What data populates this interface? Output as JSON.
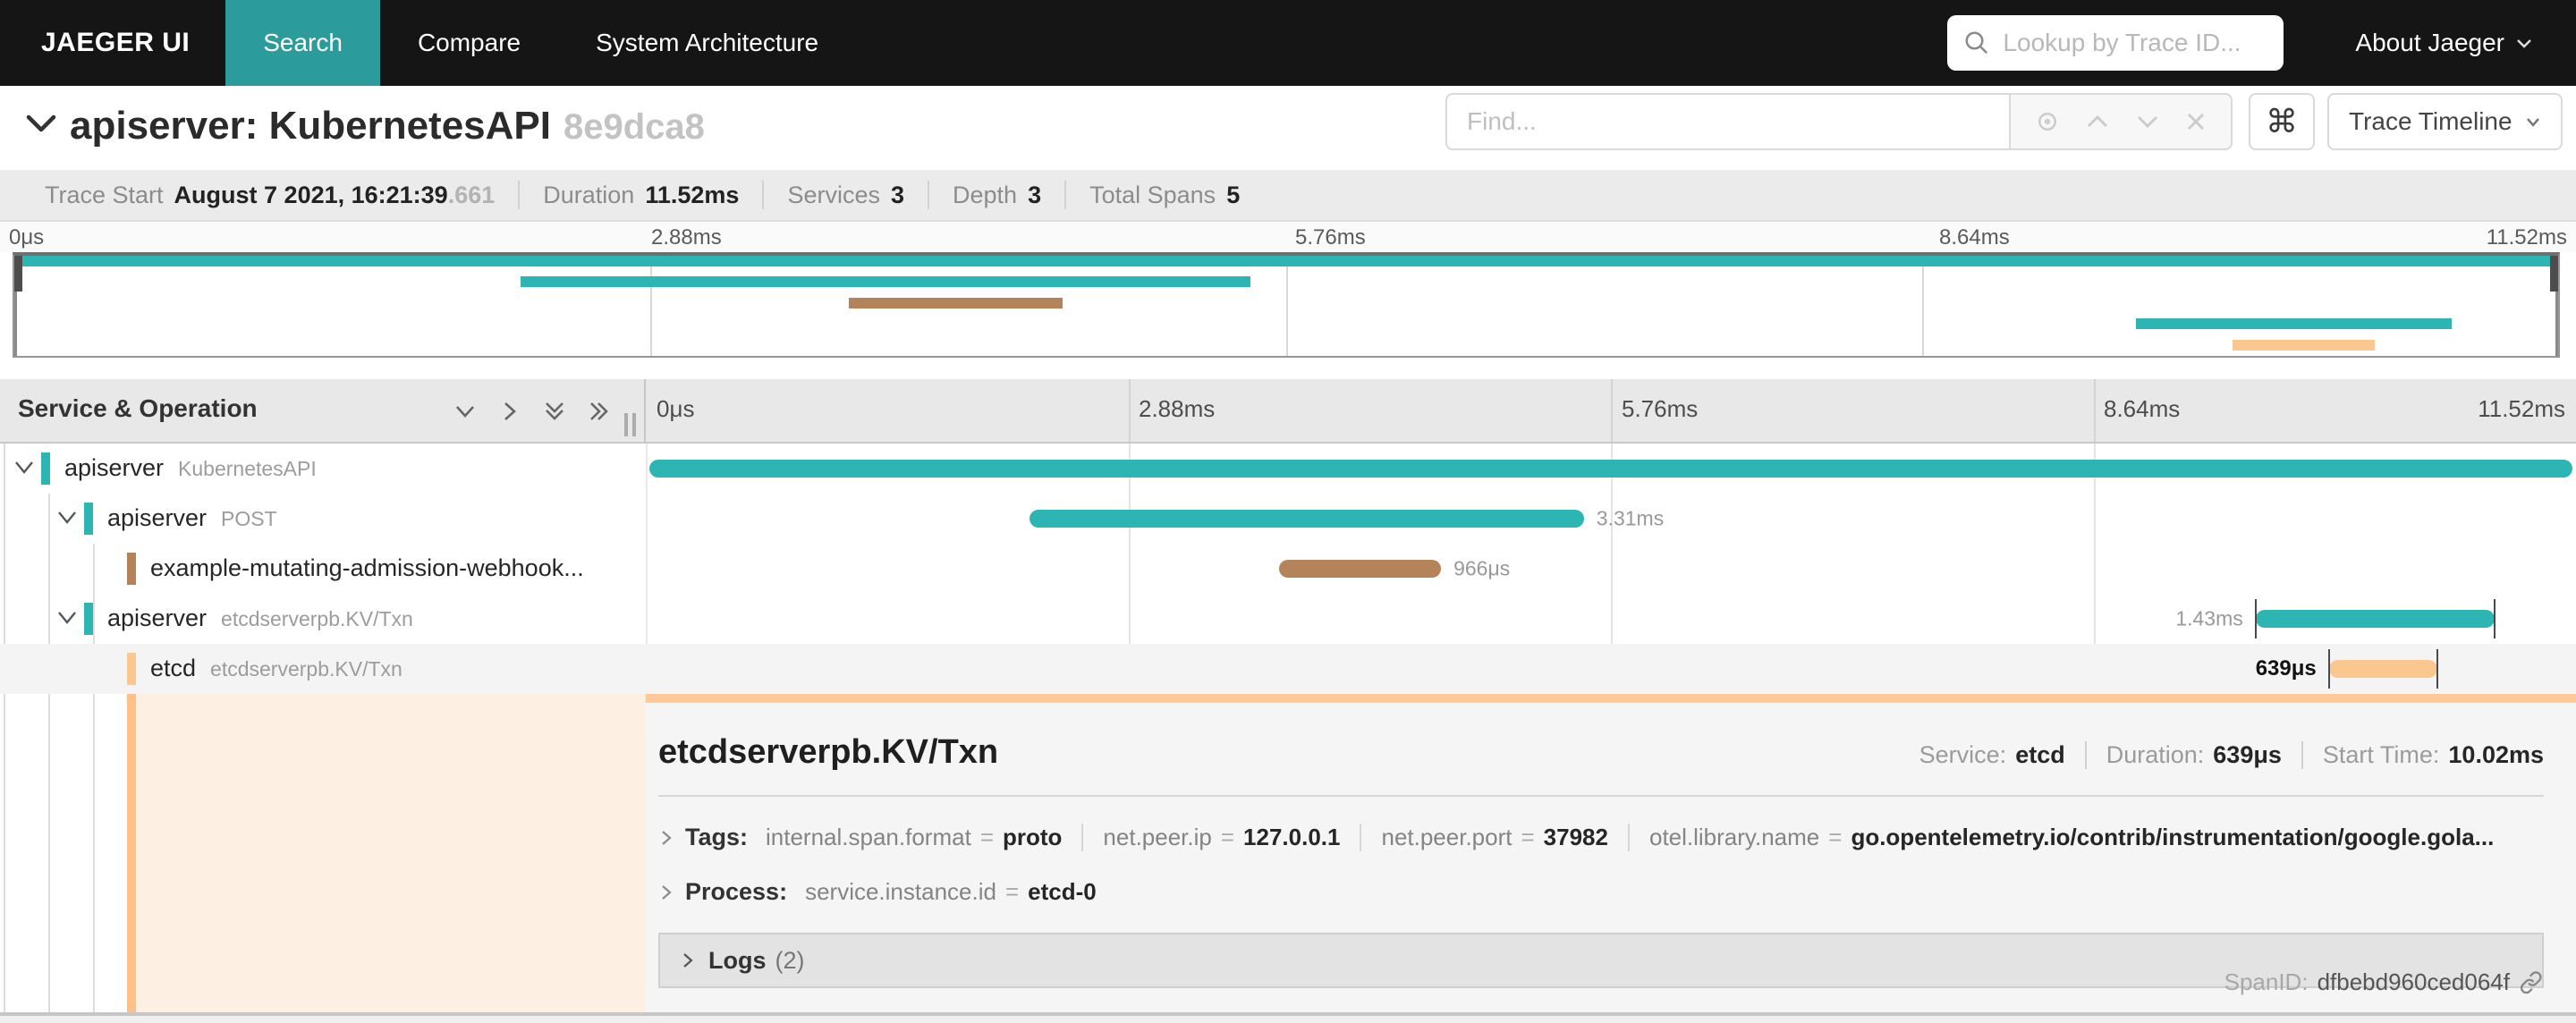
{
  "colors": {
    "teal_span": "#2cb5b2",
    "brown_span": "#b5835a",
    "peach_span": "#fac88f",
    "detail_accent": "#ffc189",
    "nav_active": "#2b9c9b",
    "nav_bg": "#151515",
    "selected_row_bg": "#f4f4f4",
    "detail_bg": "#f5f5f5"
  },
  "nav": {
    "brand": "JAEGER UI",
    "items": [
      {
        "label": "Search",
        "active": true
      },
      {
        "label": "Compare",
        "active": false
      },
      {
        "label": "System Architecture",
        "active": false
      }
    ],
    "lookup_placeholder": "Lookup by Trace ID...",
    "about_label": "About Jaeger"
  },
  "trace_header": {
    "title": "apiserver: KubernetesAPI",
    "trace_id": "8e9dca8",
    "find_placeholder": "Find...",
    "shortcut_glyph": "⌘",
    "view_label": "Trace Timeline"
  },
  "summary": {
    "items": [
      {
        "label": "Trace Start",
        "value": "August 7 2021, 16:21:39",
        "suffix": ".661"
      },
      {
        "label": "Duration",
        "value": "11.52ms",
        "suffix": ""
      },
      {
        "label": "Services",
        "value": "3",
        "suffix": ""
      },
      {
        "label": "Depth",
        "value": "3",
        "suffix": ""
      },
      {
        "label": "Total Spans",
        "value": "5",
        "suffix": ""
      }
    ]
  },
  "minimap": {
    "ticks": [
      "0μs",
      "2.88ms",
      "5.76ms",
      "8.64ms",
      "11.52ms"
    ]
  },
  "timeline": {
    "left_header": "Service & Operation",
    "ticks": [
      "0μs",
      "2.88ms",
      "5.76ms",
      "8.64ms",
      "11.52ms"
    ]
  },
  "spans": [
    {
      "service": "apiserver",
      "operation": "KubernetesAPI",
      "depth": 0,
      "has_children": true,
      "color": "#2cb5b2",
      "bar": {
        "left_pct": 0.2,
        "width_pct": 99.6
      },
      "duration_label": "",
      "label_side": "right",
      "edge_ticks": false,
      "selected": false
    },
    {
      "service": "apiserver",
      "operation": "POST",
      "depth": 1,
      "has_children": true,
      "color": "#2cb5b2",
      "bar": {
        "left_pct": 19.9,
        "width_pct": 28.7
      },
      "duration_label": "3.31ms",
      "label_side": "right",
      "edge_ticks": false,
      "selected": false
    },
    {
      "service": "example-mutating-admission-webhook...",
      "operation": "",
      "depth": 2,
      "has_children": false,
      "color": "#b5835a",
      "bar": {
        "left_pct": 32.8,
        "width_pct": 8.4
      },
      "duration_label": "966μs",
      "label_side": "right",
      "edge_ticks": false,
      "selected": false
    },
    {
      "service": "apiserver",
      "operation": "etcdserverpb.KV/Txn",
      "depth": 1,
      "has_children": true,
      "color": "#2cb5b2",
      "bar": {
        "left_pct": 83.4,
        "width_pct": 12.4
      },
      "duration_label": "1.43ms",
      "label_side": "left",
      "edge_ticks": true,
      "selected": false
    },
    {
      "service": "etcd",
      "operation": "etcdserverpb.KV/Txn",
      "depth": 2,
      "has_children": false,
      "color": "#fac88f",
      "bar": {
        "left_pct": 87.2,
        "width_pct": 5.6
      },
      "duration_label": "639μs",
      "label_side": "left",
      "edge_ticks": true,
      "selected": true
    }
  ],
  "detail": {
    "operation": "etcdserverpb.KV/Txn",
    "eq": "=",
    "meta": [
      {
        "label": "Service:",
        "value": "etcd"
      },
      {
        "label": "Duration:",
        "value": "639μs"
      },
      {
        "label": "Start Time:",
        "value": "10.02ms"
      }
    ],
    "tags_label": "Tags:",
    "tags": [
      {
        "key": "internal.span.format",
        "value": "proto"
      },
      {
        "key": "net.peer.ip",
        "value": "127.0.0.1"
      },
      {
        "key": "net.peer.port",
        "value": "37982"
      },
      {
        "key": "otel.library.name",
        "value": "go.opentelemetry.io/contrib/instrumentation/google.gola..."
      }
    ],
    "process_label": "Process:",
    "process_tags": [
      {
        "key": "service.instance.id",
        "value": "etcd-0"
      }
    ],
    "logs_label": "Logs",
    "logs_count": "(2)",
    "spanid_label": "SpanID:",
    "spanid_value": "dfbebd960ced064f"
  }
}
